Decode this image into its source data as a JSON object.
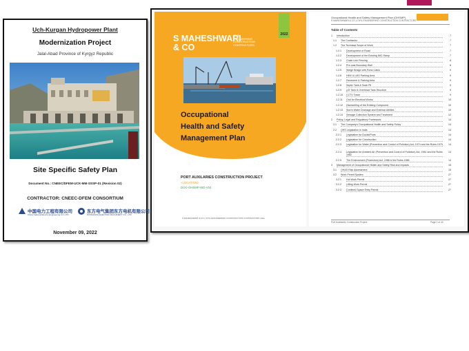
{
  "left_doc": {
    "plant_name": "Uch-Kurgan Hydropower Plant",
    "project": "Modernization Project",
    "location": "Jalal-Abad Province of Kyrgyz Republic",
    "plan_title": "Site Specific Safety Plan",
    "document_no": "Document No.: CNEEC/DFEM-UCK-MM-SSSP-01 (Revision 02)",
    "contractor": "CONTRACTOR: CNEEC-DFEM CONSORTIUM",
    "logo_a_cn": "中国电力工程有限公司",
    "logo_a_en": "China National Electric Engineering CO.,LTD",
    "logo_b_cn": "东方电气集团东方电机有限公司",
    "logo_b_en": "DONGFANG ELECTRIC MACHINERY CO., LTD",
    "date": "November 09, 2022"
  },
  "cover": {
    "year": "2022",
    "brand_main": "S MAHESHWARI\n& CO",
    "brand_sub": "CIVIL\nENGINEERING\nCONSTRUCTION\nCONTRACTORS",
    "title_line1": "Occupational",
    "title_line2": "Health and Safety",
    "title_line3": "Management Plan",
    "project": "PORT AUXILARIES CONSTRUCTION PROJECT",
    "location": "<LOCATION>",
    "doc_code": "DOC-OHSMP-WD-V04",
    "footer": "S MAHESHWARI & CO | CIVIL ENGINEERING CONSTRUCTION CONTRACTORS India",
    "colors": {
      "orange": "#f7a823",
      "green": "#8cc63f"
    }
  },
  "toc": {
    "header_title": "Occupational Health and Safety Management Plan (OHSMP)",
    "header_sub": "S MAHESHWARI & CO | CIVIL ENGINEERING CONSTRUCTION CONTRACTORS",
    "heading": "Table of Contents",
    "footer_left": "Port Auxiliaries Construction Project",
    "footer_right": "Page 2 of 40",
    "entries": [
      {
        "level": 1,
        "num": "1",
        "text": "Introduction",
        "page": "7"
      },
      {
        "level": 2,
        "num": "1.1",
        "text": "The Contractor",
        "page": "7"
      },
      {
        "level": 2,
        "num": "1.2",
        "text": "The Technical Scope of Work",
        "page": "7"
      },
      {
        "level": 3,
        "num": "1.2.1",
        "text": "Development of Road",
        "page": "7"
      },
      {
        "level": 3,
        "num": "1.2.2",
        "text": "Development of the Existing IMC Ramp",
        "page": "7"
      },
      {
        "level": 3,
        "num": "1.2.3",
        "text": "Chain Link Fencing",
        "page": "8"
      },
      {
        "level": 3,
        "num": "1.2.4",
        "text": "Pre-cast Boundary Wall",
        "page": "8"
      },
      {
        "level": 3,
        "num": "1.2.5",
        "text": "Weigh Bridge with Porta Cabin",
        "page": "9"
      },
      {
        "level": 3,
        "num": "1.2.6",
        "text": "HMV & LMV Parking Area",
        "page": "9"
      },
      {
        "level": 3,
        "num": "1.2.7",
        "text": "Pavement & Parking Area",
        "page": "9"
      },
      {
        "level": 3,
        "num": "1.2.8",
        "text": "Septic Tank & Soak Pit",
        "page": "9"
      },
      {
        "level": 3,
        "num": "1.2.9",
        "text": "UG Tank & Overhead Tank Structure",
        "page": "9"
      },
      {
        "level": 3,
        "num": "1.2.10",
        "text": "CCTV Tower",
        "page": "9"
      },
      {
        "level": 3,
        "num": "1.2.11",
        "text": "Civil for Electrical Works",
        "page": "10"
      },
      {
        "level": 3,
        "num": "1.2.12",
        "text": "Dismantling of the Existing Compound",
        "page": "10"
      },
      {
        "level": 3,
        "num": "1.2.13",
        "text": "Storm Water Drainage and External Utilities",
        "page": "10"
      },
      {
        "level": 3,
        "num": "1.2.14",
        "text": "Sewage Collection System and Treatment",
        "page": "12"
      },
      {
        "level": 1,
        "num": "2",
        "text": "Policy, Legal and Regulatory Framework",
        "page": "14"
      },
      {
        "level": 2,
        "num": "2.1",
        "text": "The Company's Occupational Health and Safety Policy",
        "page": "14"
      },
      {
        "level": 2,
        "num": "2.2",
        "text": "OHS Legislation in India",
        "page": "14"
      },
      {
        "level": 3,
        "num": "2.2.1",
        "text": "Legislation for Docks/Ports",
        "page": "14"
      },
      {
        "level": 3,
        "num": "2.2.2",
        "text": "Legislation for Construction",
        "page": "14"
      },
      {
        "level": 3,
        "num": "2.2.3",
        "text": "Legislation for Water (Prevention and Control of Pollution) Act, 1974 and the Rules 1975",
        "page": "14",
        "tall": true
      },
      {
        "level": 3,
        "num": "2.2.4",
        "text": "Legislation for Ambient Air (Prevention and Control of Pollution) Act, 1981 and the Rules 1982",
        "page": "14",
        "tall": true
      },
      {
        "level": 3,
        "num": "2.2.5",
        "text": "The Environment (Protection) Act, 1986 & the Rules 1986",
        "page": "14"
      },
      {
        "level": 1,
        "num": "3",
        "text": "Management of Occupational Health and Safety Risk and Impacts",
        "page": "15"
      },
      {
        "level": 2,
        "num": "3.1",
        "text": "OH&S Risk Assessment",
        "page": "15"
      },
      {
        "level": 2,
        "num": "3.2",
        "text": "Work Permit System",
        "page": "27"
      },
      {
        "level": 3,
        "num": "3.2.1",
        "text": "Hot Work Permit",
        "page": "27"
      },
      {
        "level": 3,
        "num": "3.2.2",
        "text": "Lifting Work Permit",
        "page": "27"
      },
      {
        "level": 3,
        "num": "3.2.3",
        "text": "Confined Space Entry Permit",
        "page": "27"
      }
    ]
  }
}
